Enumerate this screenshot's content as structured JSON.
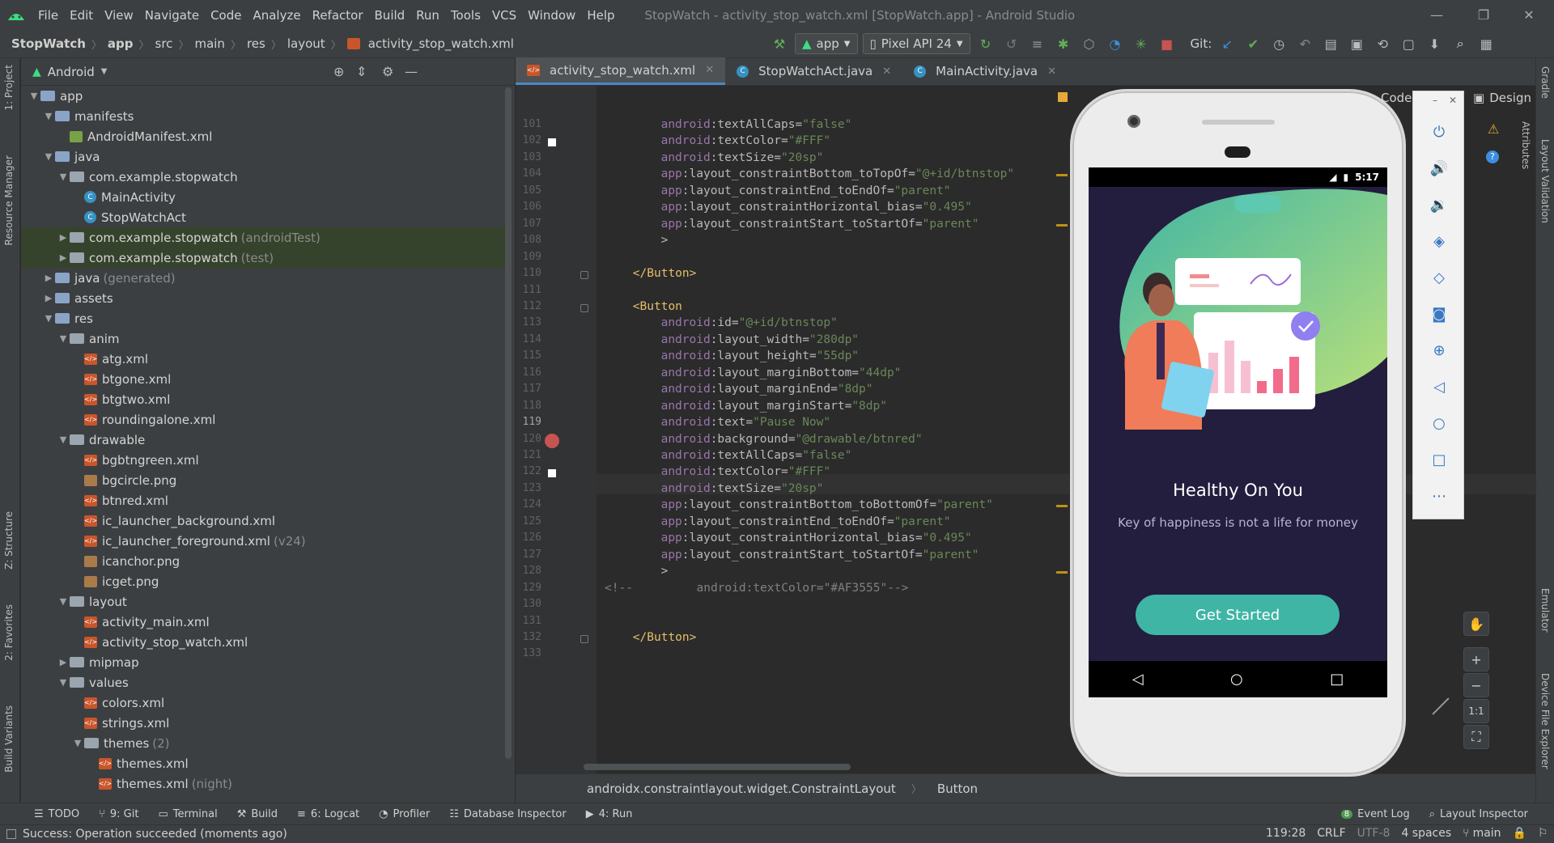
{
  "window": {
    "title": "StopWatch - activity_stop_watch.xml [StopWatch.app] - Android Studio"
  },
  "menu": [
    "File",
    "Edit",
    "View",
    "Navigate",
    "Code",
    "Analyze",
    "Refactor",
    "Build",
    "Run",
    "Tools",
    "VCS",
    "Window",
    "Help"
  ],
  "breadcrumb": {
    "project": "StopWatch",
    "items": [
      "app",
      "src",
      "main",
      "res",
      "layout"
    ],
    "file": "activity_stop_watch.xml"
  },
  "toolbar": {
    "run_config": "app",
    "device": "Pixel API 24",
    "git_label": "Git:"
  },
  "project_panel": {
    "view_mode": "Android"
  },
  "tree": [
    {
      "label": "app",
      "extra": "",
      "indent": 0,
      "icon": "folder",
      "tw": "▼"
    },
    {
      "label": "manifests",
      "extra": "",
      "indent": 1,
      "icon": "folder",
      "tw": "▼"
    },
    {
      "label": "AndroidManifest.xml",
      "extra": "",
      "indent": 2,
      "icon": "mf",
      "tw": ""
    },
    {
      "label": "java",
      "extra": "",
      "indent": 1,
      "icon": "folder",
      "tw": "▼"
    },
    {
      "label": "com.example.stopwatch",
      "extra": "",
      "indent": 2,
      "icon": "pkg",
      "tw": "▼"
    },
    {
      "label": "MainActivity",
      "extra": "",
      "indent": 3,
      "icon": "cls",
      "tw": ""
    },
    {
      "label": "StopWatchAct",
      "extra": "",
      "indent": 3,
      "icon": "cls",
      "tw": ""
    },
    {
      "label": "com.example.stopwatch",
      "extra": "(androidTest)",
      "indent": 2,
      "icon": "pkg",
      "tw": "▶",
      "hl": true
    },
    {
      "label": "com.example.stopwatch",
      "extra": "(test)",
      "indent": 2,
      "icon": "pkg",
      "tw": "▶",
      "hl": true
    },
    {
      "label": "java",
      "extra": "(generated)",
      "indent": 1,
      "icon": "folder",
      "tw": "▶"
    },
    {
      "label": "assets",
      "extra": "",
      "indent": 1,
      "icon": "folder",
      "tw": "▶"
    },
    {
      "label": "res",
      "extra": "",
      "indent": 1,
      "icon": "folder",
      "tw": "▼"
    },
    {
      "label": "anim",
      "extra": "",
      "indent": 2,
      "icon": "pkg",
      "tw": "▼"
    },
    {
      "label": "atg.xml",
      "extra": "",
      "indent": 3,
      "icon": "xml",
      "tw": ""
    },
    {
      "label": "btgone.xml",
      "extra": "",
      "indent": 3,
      "icon": "xml",
      "tw": ""
    },
    {
      "label": "btgtwo.xml",
      "extra": "",
      "indent": 3,
      "icon": "xml",
      "tw": ""
    },
    {
      "label": "roundingalone.xml",
      "extra": "",
      "indent": 3,
      "icon": "xml",
      "tw": ""
    },
    {
      "label": "drawable",
      "extra": "",
      "indent": 2,
      "icon": "pkg",
      "tw": "▼"
    },
    {
      "label": "bgbtngreen.xml",
      "extra": "",
      "indent": 3,
      "icon": "xml",
      "tw": ""
    },
    {
      "label": "bgcircle.png",
      "extra": "",
      "indent": 3,
      "icon": "img",
      "tw": ""
    },
    {
      "label": "btnred.xml",
      "extra": "",
      "indent": 3,
      "icon": "xml",
      "tw": ""
    },
    {
      "label": "ic_launcher_background.xml",
      "extra": "",
      "indent": 3,
      "icon": "xml",
      "tw": ""
    },
    {
      "label": "ic_launcher_foreground.xml",
      "extra": "(v24)",
      "indent": 3,
      "icon": "xml",
      "tw": ""
    },
    {
      "label": "icanchor.png",
      "extra": "",
      "indent": 3,
      "icon": "img",
      "tw": ""
    },
    {
      "label": "icget.png",
      "extra": "",
      "indent": 3,
      "icon": "img",
      "tw": ""
    },
    {
      "label": "layout",
      "extra": "",
      "indent": 2,
      "icon": "pkg",
      "tw": "▼"
    },
    {
      "label": "activity_main.xml",
      "extra": "",
      "indent": 3,
      "icon": "xml",
      "tw": ""
    },
    {
      "label": "activity_stop_watch.xml",
      "extra": "",
      "indent": 3,
      "icon": "xml",
      "tw": ""
    },
    {
      "label": "mipmap",
      "extra": "",
      "indent": 2,
      "icon": "pkg",
      "tw": "▶"
    },
    {
      "label": "values",
      "extra": "",
      "indent": 2,
      "icon": "pkg",
      "tw": "▼"
    },
    {
      "label": "colors.xml",
      "extra": "",
      "indent": 3,
      "icon": "xml",
      "tw": ""
    },
    {
      "label": "strings.xml",
      "extra": "",
      "indent": 3,
      "icon": "xml",
      "tw": ""
    },
    {
      "label": "themes",
      "extra": "(2)",
      "indent": 3,
      "icon": "pkg",
      "tw": "▼"
    },
    {
      "label": "themes.xml",
      "extra": "",
      "indent": 4,
      "icon": "xml",
      "tw": ""
    },
    {
      "label": "themes.xml",
      "extra": "(night)",
      "indent": 4,
      "icon": "xml",
      "tw": ""
    }
  ],
  "editor_tabs": [
    {
      "label": "activity_stop_watch.xml",
      "active": true
    },
    {
      "label": "StopWatchAct.java",
      "active": false
    },
    {
      "label": "MainActivity.java",
      "active": false
    }
  ],
  "code_lines": [
    {
      "n": "101",
      "text": "android:textAllCaps=\"false\"",
      "indent": 8
    },
    {
      "n": "102",
      "text": "android:textColor=\"#FFF\"",
      "indent": 8
    },
    {
      "n": "103",
      "text": "android:textSize=\"20sp\"",
      "indent": 8
    },
    {
      "n": "104",
      "text": "app:layout_constraintBottom_toTopOf=\"@+id/btnstop\"",
      "indent": 8
    },
    {
      "n": "105",
      "text": "app:layout_constraintEnd_toEndOf=\"parent\"",
      "indent": 8
    },
    {
      "n": "106",
      "text": "app:layout_constraintHorizontal_bias=\"0.495\"",
      "indent": 8
    },
    {
      "n": "107",
      "text": "app:layout_constraintStart_toStartOf=\"parent\"",
      "indent": 8
    },
    {
      "n": "108",
      "text": ">",
      "indent": 8
    },
    {
      "n": "109",
      "text": "",
      "indent": 0
    },
    {
      "n": "110",
      "text": "</Button>",
      "indent": 4
    },
    {
      "n": "111",
      "text": "",
      "indent": 0
    },
    {
      "n": "112",
      "text": "<Button",
      "indent": 4
    },
    {
      "n": "113",
      "text": "android:id=\"@+id/btnstop\"",
      "indent": 8
    },
    {
      "n": "114",
      "text": "android:layout_width=\"280dp\"",
      "indent": 8
    },
    {
      "n": "115",
      "text": "android:layout_height=\"55dp\"",
      "indent": 8
    },
    {
      "n": "116",
      "text": "android:layout_marginBottom=\"44dp\"",
      "indent": 8
    },
    {
      "n": "117",
      "text": "android:layout_marginEnd=\"8dp\"",
      "indent": 8
    },
    {
      "n": "118",
      "text": "android:layout_marginStart=\"8dp\"",
      "indent": 8
    },
    {
      "n": "119",
      "text": "android:text=\"Pause Now\"",
      "indent": 8
    },
    {
      "n": "120",
      "text": "android:background=\"@drawable/btnred\"",
      "indent": 8
    },
    {
      "n": "121",
      "text": "android:textAllCaps=\"false\"",
      "indent": 8
    },
    {
      "n": "122",
      "text": "android:textColor=\"#FFF\"",
      "indent": 8
    },
    {
      "n": "123",
      "text": "android:textSize=\"20sp\"",
      "indent": 8
    },
    {
      "n": "124",
      "text": "app:layout_constraintBottom_toBottomOf=\"parent\"",
      "indent": 8
    },
    {
      "n": "125",
      "text": "app:layout_constraintEnd_toEndOf=\"parent\"",
      "indent": 8
    },
    {
      "n": "126",
      "text": "app:layout_constraintHorizontal_bias=\"0.495\"",
      "indent": 8
    },
    {
      "n": "127",
      "text": "app:layout_constraintStart_toStartOf=\"parent\"",
      "indent": 8
    },
    {
      "n": "128",
      "text": ">",
      "indent": 8
    },
    {
      "n": "129",
      "text": "<!--         android:textColor=\"#AF3555\"-->",
      "indent": 0
    },
    {
      "n": "130",
      "text": "",
      "indent": 0
    },
    {
      "n": "131",
      "text": "",
      "indent": 0
    },
    {
      "n": "132",
      "text": "</Button>",
      "indent": 4
    },
    {
      "n": "133",
      "text": "",
      "indent": 0
    }
  ],
  "editor_breadcrumb": [
    "androidx.constraintlayout.widget.ConstraintLayout",
    "Button"
  ],
  "design_tabs": {
    "code": "Code",
    "design": "Design"
  },
  "emulator": {
    "time": "5:17",
    "app_title": "Healthy On You",
    "app_subtitle": "Key of happiness is not a life for money",
    "button_label": "Get Started",
    "zoom_label": "1:1"
  },
  "left_strip": [
    "1: Project",
    "Resource Manager",
    "Z: Structure",
    "2: Favorites",
    "Build Variants"
  ],
  "right_strip": [
    "Gradle",
    "Layout Validation",
    "Emulator",
    "Device File Explorer"
  ],
  "attributes_label": "Attributes",
  "bottom_tools": [
    {
      "label": "TODO",
      "icon": "list-icon"
    },
    {
      "label": "9: Git",
      "icon": "git-icon"
    },
    {
      "label": "Terminal",
      "icon": "terminal-icon"
    },
    {
      "label": "Build",
      "icon": "hammer-icon"
    },
    {
      "label": "6: Logcat",
      "icon": "logcat-icon"
    },
    {
      "label": "Profiler",
      "icon": "profiler-icon"
    },
    {
      "label": "Database Inspector",
      "icon": "database-icon"
    },
    {
      "label": "4: Run",
      "icon": "run-icon"
    }
  ],
  "bottom_right_tools": [
    {
      "label": "Event Log",
      "badge": "8"
    },
    {
      "label": "Layout Inspector",
      "badge": ""
    }
  ],
  "status": {
    "message": "Success: Operation succeeded (moments ago)",
    "position": "119:28",
    "line_sep": "CRLF",
    "encoding": "UTF-8",
    "indent": "4 spaces",
    "branch": "main"
  },
  "colors": {
    "accent": "#4a88c7",
    "teal": "#3fb5a5",
    "screen_bg": "#231d3e",
    "breakpoint": "#c75450"
  }
}
